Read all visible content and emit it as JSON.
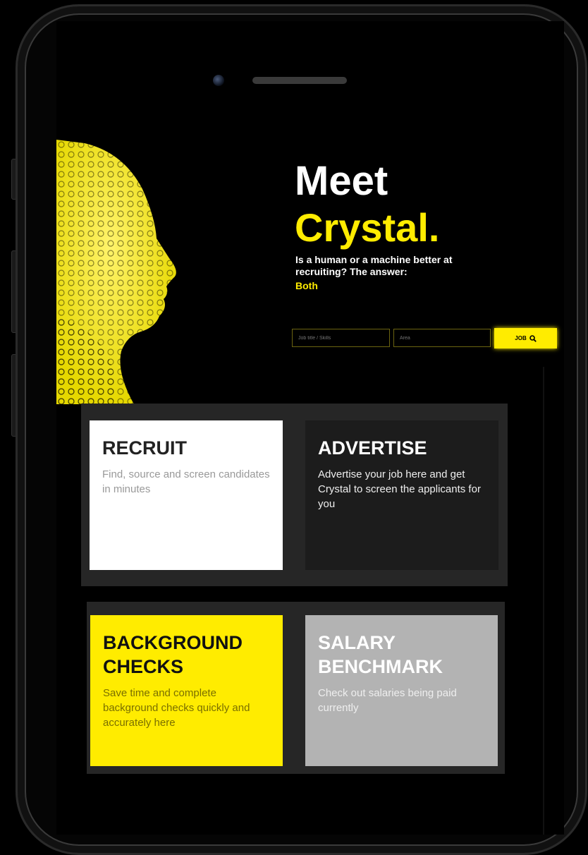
{
  "hero": {
    "title_line1": "Meet",
    "title_line2": "Crystal.",
    "subtitle": "Is a human or a machine better at recruiting? The answer:",
    "answer": "Both"
  },
  "search": {
    "keyword_placeholder": "Job title / Skills",
    "location_placeholder": "Area",
    "button_label": "JOB"
  },
  "cards": {
    "recruit": {
      "title": "RECRUIT",
      "description": "Find, source and screen candidates in minutes"
    },
    "advertise": {
      "title": "ADVERTISE",
      "description": "Advertise your job here and get Crystal to screen the applicants for you"
    },
    "background": {
      "title": "BACKGROUND CHECKS",
      "description": "Save time and complete background checks quickly and accurately here"
    },
    "salary": {
      "title": "SALARY BENCHMARK",
      "description": "Check out salaries being paid currently"
    }
  },
  "colors": {
    "accent": "#ffec00",
    "background": "#000000",
    "panel": "#262626",
    "card_dark": "#1c1c1c",
    "card_grey": "#b3b3b3"
  },
  "icons": {
    "search_button": "search-icon",
    "hero_image": "crystal-face-silhouette"
  }
}
